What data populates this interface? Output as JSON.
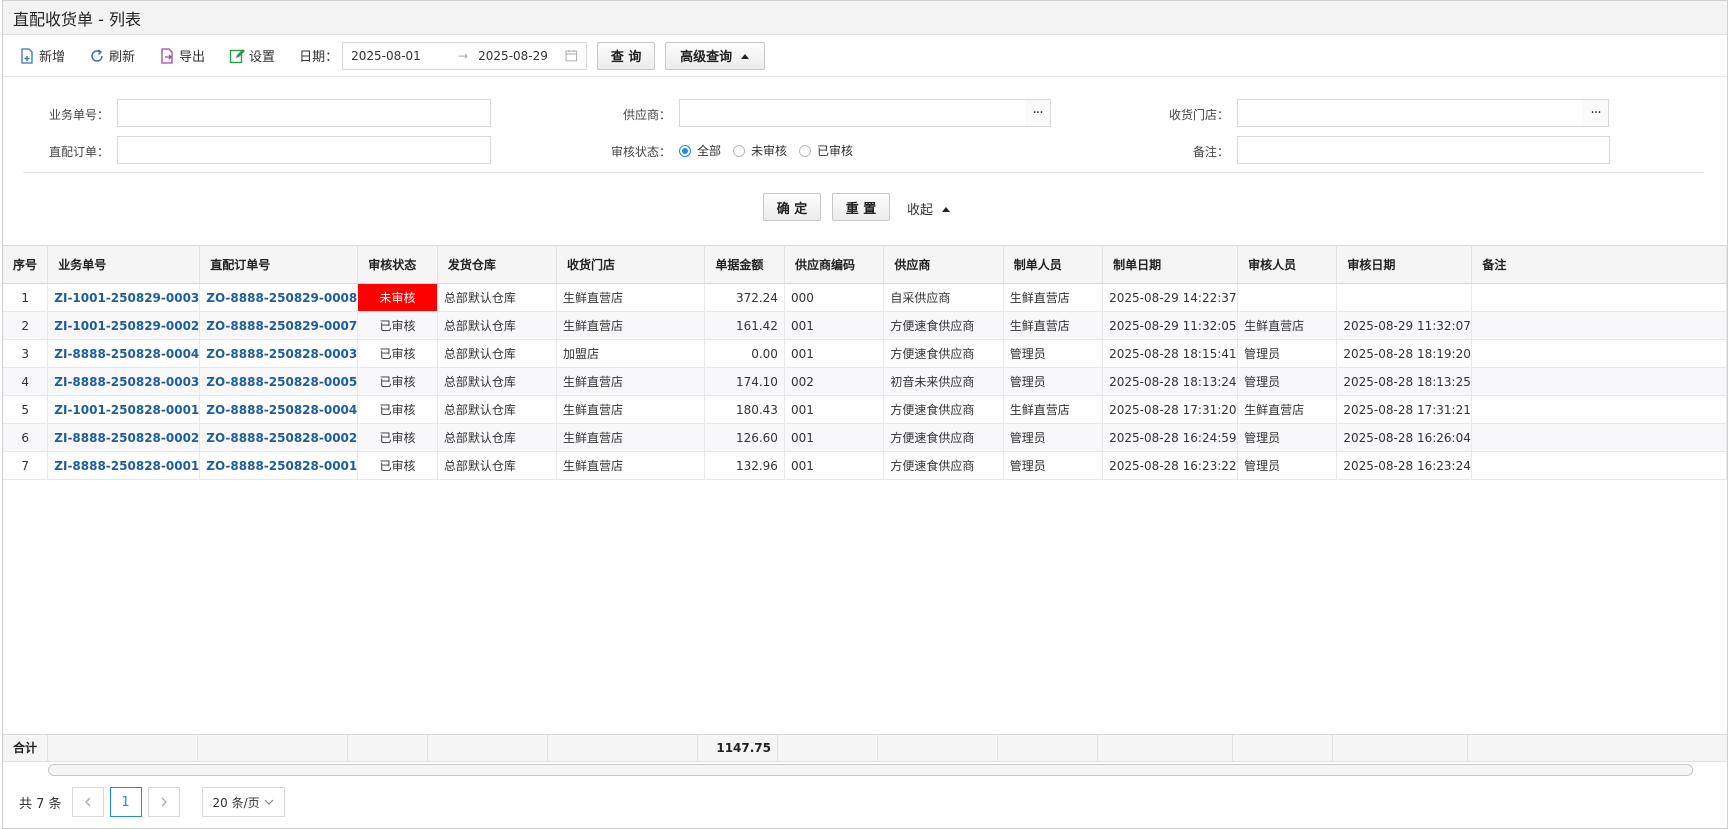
{
  "title": "直配收货单 - 列表",
  "toolbar": {
    "add_label": "新增",
    "refresh_label": "刷新",
    "export_label": "导出",
    "settings_label": "设置",
    "date_label": "日期：",
    "date_from": "2025-08-01",
    "date_to": "2025-08-29",
    "query_label": "查 询",
    "advanced_label": "高级查询"
  },
  "filters": {
    "biz_no_label": "业务单号：",
    "order_no_label": "直配订单：",
    "supplier_label": "供应商：",
    "status_label": "审核状态：",
    "status_options": [
      "全部",
      "未审核",
      "已审核"
    ],
    "store_label": "收货门店：",
    "remark_label": "备注：",
    "confirm_label": "确 定",
    "reset_label": "重 置",
    "collapse_label": "收起"
  },
  "table": {
    "headers": [
      "序号",
      "业务单号",
      "直配订单号",
      "审核状态",
      "发货仓库",
      "收货门店",
      "单据金额",
      "供应商编码",
      "供应商",
      "制单人员",
      "制单日期",
      "审核人员",
      "审核日期",
      "备注"
    ],
    "rows": [
      [
        "1",
        "ZI-1001-250829-0003",
        "ZO-8888-250829-0008",
        "未审核",
        "总部默认仓库",
        "生鲜直营店",
        "372.24",
        "000",
        "自采供应商",
        "生鲜直营店",
        "2025-08-29 14:22:37",
        "",
        "",
        ""
      ],
      [
        "2",
        "ZI-1001-250829-0002",
        "ZO-8888-250829-0007",
        "已审核",
        "总部默认仓库",
        "生鲜直营店",
        "161.42",
        "001",
        "方便速食供应商",
        "生鲜直营店",
        "2025-08-29 11:32:05",
        "生鲜直营店",
        "2025-08-29 11:32:07",
        ""
      ],
      [
        "3",
        "ZI-8888-250828-0004",
        "ZO-8888-250828-0003",
        "已审核",
        "总部默认仓库",
        "加盟店",
        "0.00",
        "001",
        "方便速食供应商",
        "管理员",
        "2025-08-28 18:15:41",
        "管理员",
        "2025-08-28 18:19:20",
        ""
      ],
      [
        "4",
        "ZI-8888-250828-0003",
        "ZO-8888-250828-0005",
        "已审核",
        "总部默认仓库",
        "生鲜直营店",
        "174.10",
        "002",
        "初音未来供应商",
        "管理员",
        "2025-08-28 18:13:24",
        "管理员",
        "2025-08-28 18:13:25",
        ""
      ],
      [
        "5",
        "ZI-1001-250828-0001",
        "ZO-8888-250828-0004",
        "已审核",
        "总部默认仓库",
        "生鲜直营店",
        "180.43",
        "001",
        "方便速食供应商",
        "生鲜直营店",
        "2025-08-28 17:31:20",
        "生鲜直营店",
        "2025-08-28 17:31:21",
        ""
      ],
      [
        "6",
        "ZI-8888-250828-0002",
        "ZO-8888-250828-0002",
        "已审核",
        "总部默认仓库",
        "生鲜直营店",
        "126.60",
        "001",
        "方便速食供应商",
        "管理员",
        "2025-08-28 16:24:59",
        "管理员",
        "2025-08-28 16:26:04",
        ""
      ],
      [
        "7",
        "ZI-8888-250828-0001",
        "ZO-8888-250828-0001",
        "已审核",
        "总部默认仓库",
        "生鲜直营店",
        "132.96",
        "001",
        "方便速食供应商",
        "管理员",
        "2025-08-28 16:23:22",
        "管理员",
        "2025-08-28 16:23:24",
        ""
      ]
    ],
    "total_label": "合计",
    "total_amount": "1147.75"
  },
  "pager": {
    "total_text": "共 7 条",
    "current_page": "1",
    "page_size": "20 条/页"
  },
  "colors": {
    "unapproved_bg": "#ff0000",
    "link": "#1f5d9a",
    "accent": "#1e8ae6"
  }
}
